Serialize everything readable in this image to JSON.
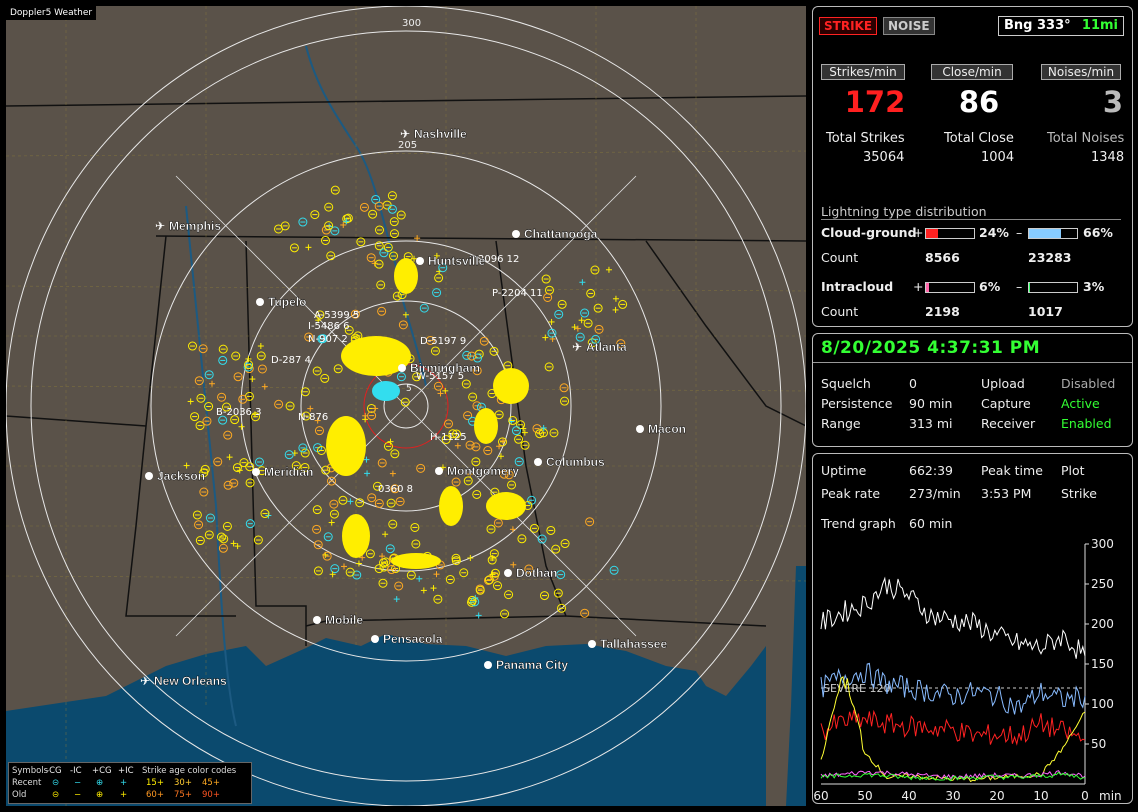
{
  "app": {
    "title": "Doppler5 Weather"
  },
  "map": {
    "cities": [
      {
        "name": "Nashville",
        "airport": true
      },
      {
        "name": "Memphis",
        "airport": true
      },
      {
        "name": "Chattanooga",
        "airport": false
      },
      {
        "name": "Huntsville",
        "airport": false
      },
      {
        "name": "Tupelo",
        "airport": false
      },
      {
        "name": "Birmingham",
        "airport": false
      },
      {
        "name": "Atlanta",
        "airport": true
      },
      {
        "name": "Macon",
        "airport": false
      },
      {
        "name": "Jackson",
        "airport": false
      },
      {
        "name": "Meridian",
        "airport": false
      },
      {
        "name": "Montgomery",
        "airport": false
      },
      {
        "name": "Columbus",
        "airport": false
      },
      {
        "name": "Dothan",
        "airport": false
      },
      {
        "name": "Mobile",
        "airport": false
      },
      {
        "name": "Pensacola",
        "airport": false
      },
      {
        "name": "Tallahassee",
        "airport": false
      },
      {
        "name": "Panama City",
        "airport": false
      },
      {
        "name": "New Orleans",
        "airport": true
      }
    ],
    "range_labels": [
      "300",
      "205",
      "5"
    ],
    "cell_labels": [
      "2096 12",
      "P-2204 11",
      "A-5399 5",
      "I-5486 6",
      "N-907 2",
      "D-5197 9",
      "D-287 4",
      "W-5157 5",
      "B-2036 3",
      "N-876",
      "H-1125",
      "0360 8"
    ]
  },
  "legend": {
    "symbols_label": "Symbols",
    "col_headers": [
      "-CG",
      "-IC",
      "+CG",
      "+IC"
    ],
    "age_label": "Strike age color codes",
    "recent_label": "Recent",
    "old_label": "Old",
    "recent_ages": [
      "15+",
      "30+",
      "45+"
    ],
    "old_ages": [
      "60+",
      "75+",
      "90+"
    ]
  },
  "status": {
    "strike_btn": "STRIKE",
    "noise_btn": "NOISE",
    "bearing": "Bng 333°",
    "bearing_dist": "11mi",
    "strikes_min_label": "Strikes/min",
    "close_min_label": "Close/min",
    "noises_min_label": "Noises/min",
    "strikes_min": "172",
    "close_min": "86",
    "noises_min": "3",
    "total_strikes_label": "Total Strikes",
    "total_close_label": "Total Close",
    "total_noises_label": "Total Noises",
    "total_strikes": "35064",
    "total_close": "1004",
    "total_noises": "1348",
    "dist_title": "Lightning type distribution",
    "cg_label": "Cloud-ground",
    "ic_label": "Intracloud",
    "count_label": "Count",
    "plus": "+",
    "minus": "–",
    "cg_pos_pct": "24%",
    "cg_neg_pct": "66%",
    "ic_pos_pct": "6%",
    "ic_neg_pct": "3%",
    "cg_pos_count": "8566",
    "cg_neg_count": "23283",
    "ic_pos_count": "2198",
    "ic_neg_count": "1017",
    "cg_pos_frac": 0.24,
    "cg_neg_frac": 0.66,
    "ic_pos_frac": 0.06,
    "ic_neg_frac": 0.03
  },
  "settings": {
    "datetime": "8/20/2025 4:37:31 PM",
    "squelch_label": "Squelch",
    "squelch": "0",
    "persistence_label": "Persistence",
    "persistence": "90 min",
    "range_label": "Range",
    "range": "313 mi",
    "upload_label": "Upload",
    "upload": "Disabled",
    "capture_label": "Capture",
    "capture": "Active",
    "receiver_label": "Receiver",
    "receiver": "Enabled"
  },
  "stats": {
    "uptime_label": "Uptime",
    "uptime": "662:39",
    "peak_time_label": "Peak time",
    "peak_time": "3:53 PM",
    "plot_label": "Plot",
    "plot": "Strike",
    "peak_rate_label": "Peak rate",
    "peak_rate": "273/min",
    "trend_label": "Trend graph",
    "trend": "60 min"
  },
  "chart_data": {
    "type": "line",
    "x": [
      60,
      55,
      50,
      45,
      40,
      35,
      30,
      25,
      20,
      15,
      10,
      5,
      0
    ],
    "x_ticks": [
      "60",
      "50",
      "40",
      "30",
      "20",
      "10",
      "0"
    ],
    "y_ticks": [
      "300",
      "250",
      "200",
      "150",
      "100",
      "50"
    ],
    "xlabel": "min",
    "ylim": [
      0,
      300
    ],
    "severe_label": "SEVERE 120",
    "severe_value": 120,
    "series": [
      {
        "color": "#ffffff",
        "values": [
          200,
          215,
          225,
          250,
          235,
          210,
          205,
          200,
          185,
          175,
          170,
          185,
          160
        ]
      },
      {
        "color": "#88bbff",
        "values": [
          120,
          135,
          140,
          125,
          120,
          115,
          110,
          115,
          110,
          95,
          115,
          105,
          110
        ]
      },
      {
        "color": "#ff2222",
        "values": [
          65,
          78,
          80,
          75,
          72,
          70,
          68,
          60,
          62,
          60,
          75,
          65,
          55
        ]
      },
      {
        "color": "#ffff33",
        "values": [
          30,
          140,
          40,
          8,
          10,
          8,
          6,
          6,
          8,
          10,
          12,
          45,
          90
        ]
      },
      {
        "color": "#ff66ff",
        "values": [
          10,
          12,
          15,
          14,
          12,
          10,
          9,
          10,
          11,
          10,
          12,
          15,
          10
        ]
      },
      {
        "color": "#33ff33",
        "values": [
          8,
          10,
          12,
          10,
          8,
          8,
          7,
          8,
          9,
          8,
          10,
          12,
          8
        ]
      }
    ]
  },
  "colors": {
    "cg_pos": "#ff2222",
    "cg_neg": "#88ccff",
    "ic_pos": "#ff66aa",
    "ic_neg": "#33ff66"
  }
}
